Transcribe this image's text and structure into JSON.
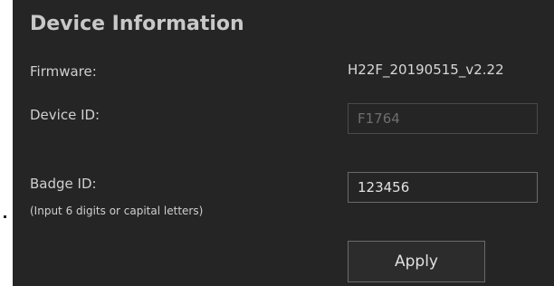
{
  "panel": {
    "title": "Device Information",
    "firmware": {
      "label": "Firmware:",
      "value": "H22F_20190515_v2.22"
    },
    "device_id": {
      "label": "Device ID:",
      "value": "F1764"
    },
    "badge_id": {
      "label": "Badge ID:",
      "hint": "(Input 6 digits or capital letters)",
      "value": "123456"
    },
    "apply_label": "Apply"
  },
  "colors": {
    "panel_background": "#252525",
    "text": "#d4d4d4",
    "field_border": "#5a5a5a",
    "disabled_text": "#6e6e6e"
  }
}
